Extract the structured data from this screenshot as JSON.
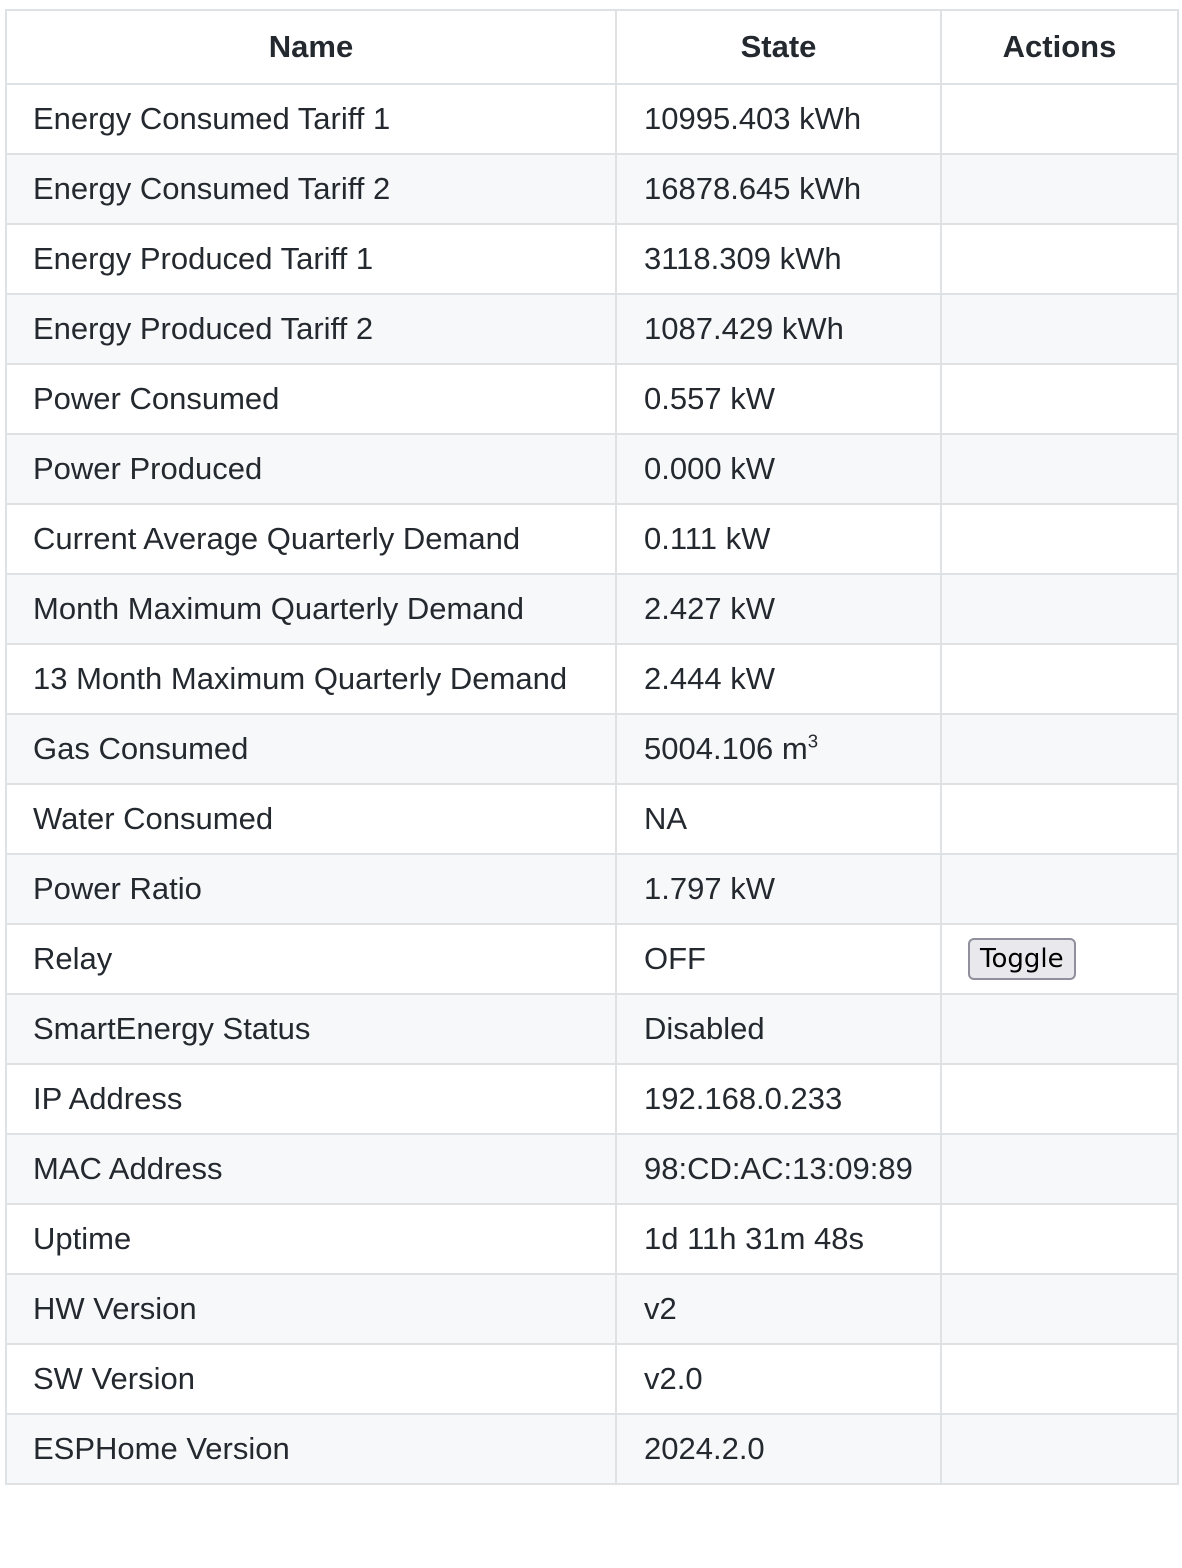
{
  "table": {
    "headers": {
      "name": "Name",
      "state": "State",
      "actions": "Actions"
    },
    "rows": [
      {
        "name": "Energy Consumed Tariff 1",
        "state": "10995.403 kWh"
      },
      {
        "name": "Energy Consumed Tariff 2",
        "state": "16878.645 kWh"
      },
      {
        "name": "Energy Produced Tariff 1",
        "state": "3118.309 kWh"
      },
      {
        "name": "Energy Produced Tariff 2",
        "state": "1087.429 kWh"
      },
      {
        "name": "Power Consumed",
        "state": "0.557 kW"
      },
      {
        "name": "Power Produced",
        "state": "0.000 kW"
      },
      {
        "name": "Current Average Quarterly Demand",
        "state": "0.111 kW"
      },
      {
        "name": "Month Maximum Quarterly Demand",
        "state": "2.427 kW"
      },
      {
        "name": "13 Month Maximum Quarterly Demand",
        "state": "2.444 kW"
      },
      {
        "name": "Gas Consumed",
        "state": "5004.106 m",
        "state_sup": "3"
      },
      {
        "name": "Water Consumed",
        "state": "NA"
      },
      {
        "name": "Power Ratio",
        "state": "1.797 kW"
      },
      {
        "name": "Relay",
        "state": "OFF",
        "action_label": "Toggle"
      },
      {
        "name": "SmartEnergy Status",
        "state": "Disabled"
      },
      {
        "name": "IP Address",
        "state": "192.168.0.233"
      },
      {
        "name": "MAC Address",
        "state": "98:CD:AC:13:09:89"
      },
      {
        "name": "Uptime",
        "state": "1d 11h 31m 48s"
      },
      {
        "name": "HW Version",
        "state": "v2"
      },
      {
        "name": "SW Version",
        "state": "v2.0"
      },
      {
        "name": "ESPHome Version",
        "state": "2024.2.0"
      }
    ]
  }
}
